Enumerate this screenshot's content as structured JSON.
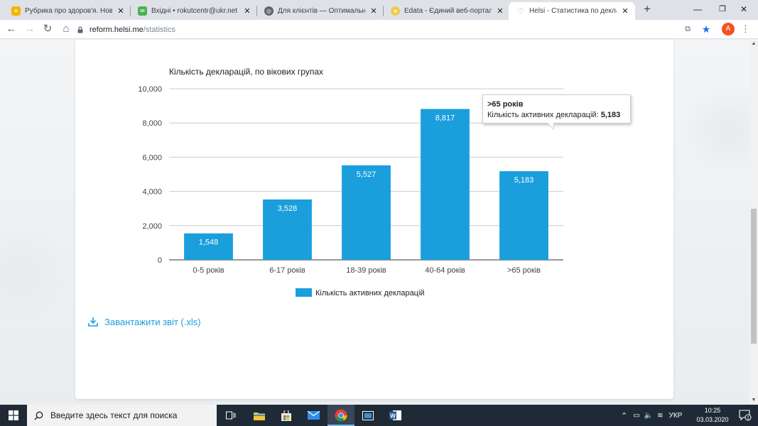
{
  "browser": {
    "tabs": [
      {
        "title": "Рубрика про здоров'я. Новини",
        "favicon_color": "#f5b400"
      },
      {
        "title": "Вхідні • rokutcentr@ukr.net",
        "favicon_color": "#4caf50"
      },
      {
        "title": "Для клієнтів — Оптимальні П",
        "favicon_color": "#5f6368"
      },
      {
        "title": "Edata - Єдиний веб-портал вик",
        "favicon_color": "#f2c94c"
      },
      {
        "title": "Helsi - Статистика по декларац",
        "favicon_color": "#ef9aa8"
      }
    ],
    "url_host": "reform.helsi.me",
    "url_path": "/statistics",
    "profile_initial": "A"
  },
  "page": {
    "download_label": "Завантажити звіт (.xls)"
  },
  "chart_data": {
    "type": "bar",
    "title": "Кількість декларацій, по вікових групах",
    "categories": [
      "0-5 років",
      "6-17 років",
      "18-39 років",
      "40-64 років",
      ">65 років"
    ],
    "series": [
      {
        "name": "Кількість активних декларацій",
        "values": [
          1548,
          3528,
          5527,
          8817,
          5183
        ],
        "color": "#1a9fdc"
      }
    ],
    "data_labels": [
      "1,548",
      "3,528",
      "5,527",
      "8,817",
      "5,183"
    ],
    "ylim": [
      0,
      10000
    ],
    "yticks": [
      "0",
      "2,000",
      "4,000",
      "6,000",
      "8,000",
      "10,000"
    ],
    "grid": true,
    "legend": "bottom-center"
  },
  "tooltip": {
    "title": ">65 років",
    "label": "Кількість активних декларацій: ",
    "value": "5,183"
  },
  "taskbar": {
    "search_placeholder": "Введите здесь текст для поиска",
    "language": "УКР",
    "time": "10:25",
    "date": "03.03.2020",
    "notification_count": "1"
  }
}
